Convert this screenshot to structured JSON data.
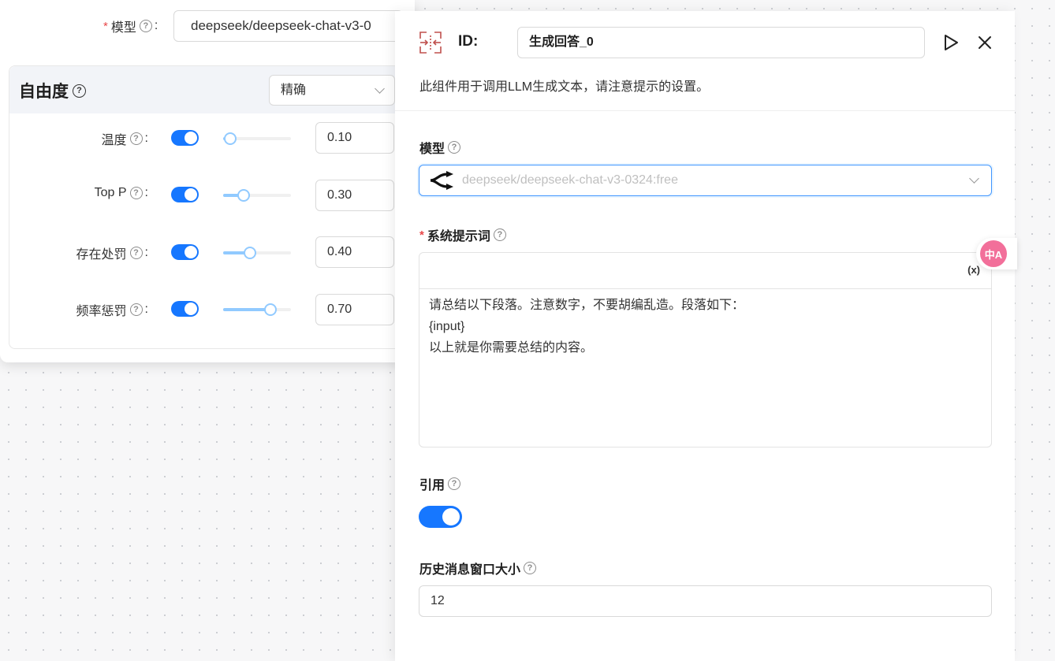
{
  "popover": {
    "model_label": "模型",
    "model_value": "deepseek/deepseek-chat-v3-0",
    "freedom": {
      "title": "自由度",
      "preset": "精确",
      "params": [
        {
          "label": "温度",
          "value": "0.10",
          "fraction": 0.1
        },
        {
          "label": "Top P",
          "value": "0.30",
          "fraction": 0.3
        },
        {
          "label": "存在处罚",
          "value": "0.40",
          "fraction": 0.4
        },
        {
          "label": "频率惩罚",
          "value": "0.70",
          "fraction": 0.7
        }
      ]
    }
  },
  "drawer": {
    "id_label": "ID:",
    "id_value": "生成回答_0",
    "description": "此组件用于调用LLM生成文本，请注意提示的设置。",
    "model_label": "模型",
    "model_value": "deepseek/deepseek-chat-v3-0324:free",
    "system_prompt_label": "系统提示词",
    "variable_button": "(x)",
    "system_prompt_lines": [
      "请总结以下段落。注意数字，不要胡编乱造。段落如下：",
      "{input}",
      "以上就是你需要总结的内容。"
    ],
    "quote_label": "引用",
    "quote_enabled": true,
    "history_label": "历史消息窗口大小",
    "history_value": "12"
  },
  "translate_fab": "中A",
  "colors": {
    "accent": "#1677ff",
    "slider": "#91caff",
    "required": "#e84749",
    "node_icon": "#c0504d",
    "translate": "#f26f9a"
  },
  "icons": [
    "help-icon",
    "node-icon",
    "run-icon",
    "close-icon",
    "openrouter-logo-icon",
    "chevron-down-icon",
    "translate-icon"
  ]
}
